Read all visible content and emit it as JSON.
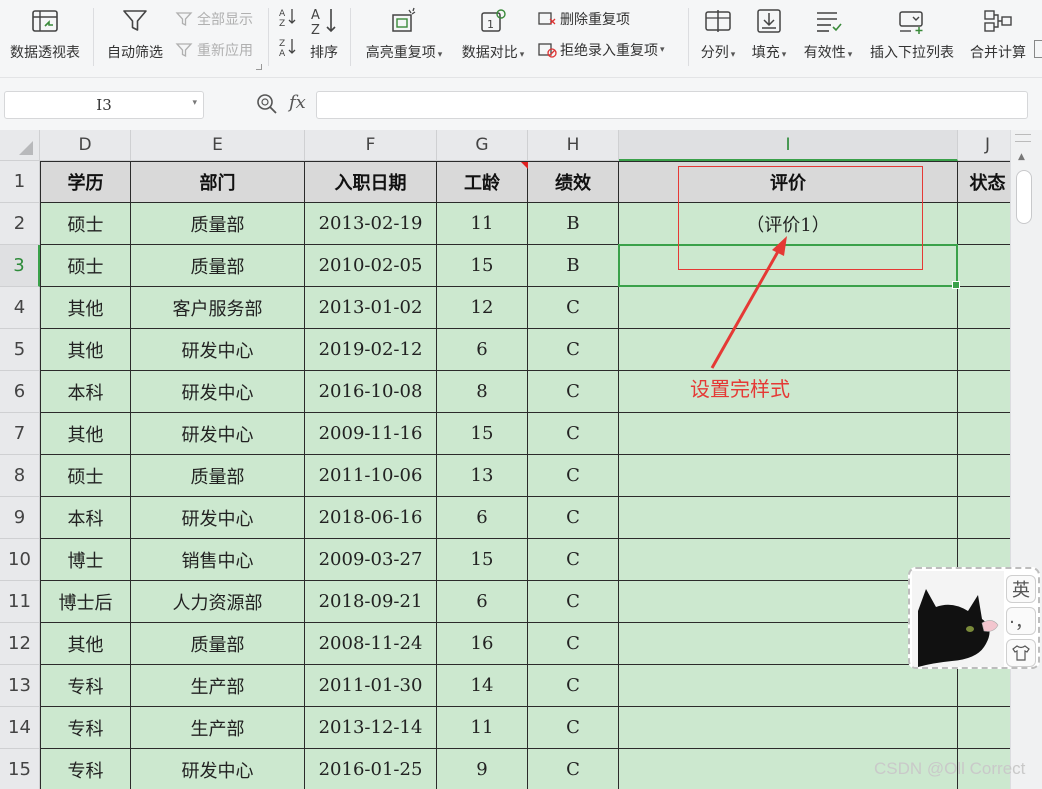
{
  "ribbon": {
    "pivot_label": "数据透视表",
    "autofilter_label": "自动筛选",
    "show_all_label": "全部显示",
    "reapply_label": "重新应用",
    "sort_label": "排序",
    "highlight_dup_label": "高亮重复项",
    "data_compare_label": "数据对比",
    "delete_dup_label": "删除重复项",
    "reject_dup_label": "拒绝录入重复项",
    "split_label": "分列",
    "fill_label": "填充",
    "validity_label": "有效性",
    "insert_dropdown_label": "插入下拉列表",
    "consolidate_label": "合并计算"
  },
  "formula_bar": {
    "name_box": "I3",
    "fx_label": "fx",
    "formula": ""
  },
  "columns": [
    "D",
    "E",
    "F",
    "G",
    "H",
    "I",
    "J"
  ],
  "rows": [
    "1",
    "2",
    "3",
    "4",
    "5",
    "6",
    "7",
    "8",
    "9",
    "10",
    "11",
    "12",
    "13",
    "14",
    "15"
  ],
  "table": {
    "headers": [
      "学历",
      "部门",
      "入职日期",
      "工龄",
      "绩效",
      "评价",
      "状态"
    ],
    "data": [
      [
        "硕士",
        "质量部",
        "2013-02-19",
        "11",
        "B",
        "（评价1）",
        ""
      ],
      [
        "硕士",
        "质量部",
        "2010-02-05",
        "15",
        "B",
        "",
        ""
      ],
      [
        "其他",
        "客户服务部",
        "2013-01-02",
        "12",
        "C",
        "",
        ""
      ],
      [
        "其他",
        "研发中心",
        "2019-02-12",
        "6",
        "C",
        "",
        ""
      ],
      [
        "本科",
        "研发中心",
        "2016-10-08",
        "8",
        "C",
        "",
        ""
      ],
      [
        "其他",
        "研发中心",
        "2009-11-16",
        "15",
        "C",
        "",
        ""
      ],
      [
        "硕士",
        "质量部",
        "2011-10-06",
        "13",
        "C",
        "",
        ""
      ],
      [
        "本科",
        "研发中心",
        "2018-06-16",
        "6",
        "C",
        "",
        ""
      ],
      [
        "博士",
        "销售中心",
        "2009-03-27",
        "15",
        "C",
        "",
        ""
      ],
      [
        "博士后",
        "人力资源部",
        "2018-09-21",
        "6",
        "C",
        "",
        ""
      ],
      [
        "其他",
        "质量部",
        "2008-11-24",
        "16",
        "C",
        "",
        ""
      ],
      [
        "专科",
        "生产部",
        "2011-01-30",
        "14",
        "C",
        "",
        ""
      ],
      [
        "专科",
        "生产部",
        "2013-12-14",
        "11",
        "C",
        "",
        ""
      ],
      [
        "专科",
        "研发中心",
        "2016-01-25",
        "9",
        "C",
        "",
        ""
      ]
    ]
  },
  "selected_cell": "I3",
  "annotation": {
    "text": "设置完样式",
    "color": "#e53935"
  },
  "ime": {
    "lang_label": "英",
    "punct_label": "·，",
    "skin_label": "skin"
  },
  "watermark": "CSDN @Oll Correct",
  "colors": {
    "cell_fill": "#cce8cf",
    "header_fill": "#d9d9d9",
    "selection": "#3aa14a",
    "annotation": "#e53935"
  }
}
